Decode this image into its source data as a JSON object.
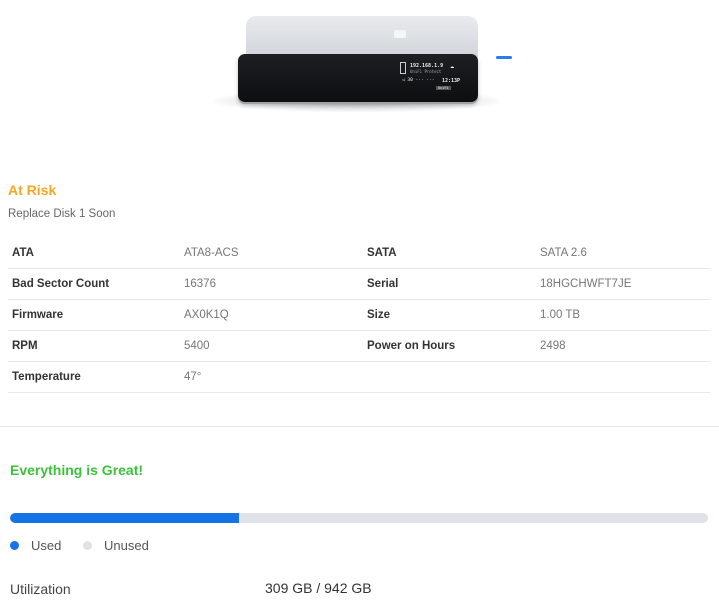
{
  "colors": {
    "at_risk": "#f5a623",
    "great": "#3cc13b",
    "used": "#1473e6",
    "unused": "#dfe2e7"
  },
  "device": {
    "screen": {
      "ip": "192.168.1.9",
      "sub": "UniFi Protect",
      "row2": "◁ 30  ··· ···",
      "time": "12:13P",
      "brand": "UniFi"
    }
  },
  "disk": {
    "status": "At Risk",
    "message": "Replace Disk 1 Soon",
    "rows": [
      {
        "l1": "ATA",
        "v1": "ATA8-ACS",
        "l2": "SATA",
        "v2": "SATA 2.6"
      },
      {
        "l1": "Bad Sector Count",
        "v1": "16376",
        "l2": "Serial",
        "v2": "18HGCHWFT7JE"
      },
      {
        "l1": "Firmware",
        "v1": "AX0K1Q",
        "l2": "Size",
        "v2": "1.00 TB"
      },
      {
        "l1": "RPM",
        "v1": "5400",
        "l2": "Power on Hours",
        "v2": "2498"
      },
      {
        "l1": "Temperature",
        "v1": "47°",
        "l2": "",
        "v2": ""
      }
    ]
  },
  "storage": {
    "status": "Everything is Great!",
    "used_fraction": 0.328,
    "legend_used": "Used",
    "legend_unused": "Unused",
    "utilization_label": "Utilization",
    "utilization_value": "309 GB / 942 GB"
  }
}
